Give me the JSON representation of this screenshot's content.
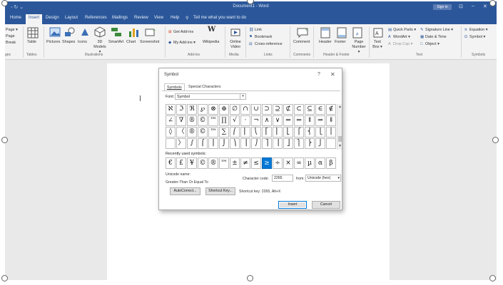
{
  "titlebar": {
    "qat": "◦ ↻ ⌄",
    "doc_title": "Document1 - Word",
    "sign_in": "Sign in",
    "share": "⊡",
    "minimize": "–",
    "restore": "❐",
    "close": "✕"
  },
  "tabs": [
    "Home",
    "Insert",
    "Design",
    "Layout",
    "References",
    "Mailings",
    "Review",
    "View",
    "Help",
    "Tell me what you want to do"
  ],
  "ribbon": {
    "pages": [
      "Page ▾",
      "Page",
      "Break"
    ],
    "pages_label": "ges",
    "table": "Table",
    "tables_label": "Tables",
    "illustrations": [
      "Pictures",
      "Shapes",
      "Icons",
      "3D Models ▾",
      "SmartArt",
      "Chart",
      "Screenshot"
    ],
    "illustrations_label": "Illustrations",
    "addins": [
      "Get Add-ins",
      "My Add-ins ▾",
      "Wikipedia"
    ],
    "addins_label": "Add-ins",
    "media": [
      "Online Video"
    ],
    "media_label": "Media",
    "links": [
      "Link",
      "Bookmark",
      "Cross-reference"
    ],
    "links_label": "Links",
    "comment": "Comment",
    "comments_label": "Comments",
    "header_footer": [
      "Header",
      "Footer",
      "Page Number ▾"
    ],
    "header_footer_label": "Header & Footer",
    "text_items": [
      "Text Box ▾",
      "Quick Parts ▾",
      "WordArt ▾",
      "Drop Cap ▾",
      "Signature Line ▾",
      "Date & Time",
      "Object ▾"
    ],
    "text_label": "Text",
    "symbols": [
      "Equation ▾",
      "Symbol ▾"
    ],
    "symbols_label": "Symbols"
  },
  "dialog": {
    "title": "Symbol",
    "help": "?",
    "close": "✕",
    "tabs": [
      "Symbols",
      "Special Characters"
    ],
    "font_label": "Font:",
    "font_value": "Symbol",
    "symbols": [
      [
        "ℵ",
        "ℑ",
        "ℜ",
        "℘",
        "⊗",
        "⊕",
        "∅",
        "∩",
        "∪",
        "⊃",
        "⊇",
        "⊄",
        "⊂",
        "⊆",
        "∈",
        "∉"
      ],
      [
        "∠",
        "∇",
        "®",
        "©",
        "™",
        "∏",
        "√",
        "⋅",
        "¬",
        "∧",
        "∨",
        "⇔",
        "⇐",
        "⇑",
        "⇒",
        "⇓"
      ],
      [
        "◊",
        "〈",
        "®",
        "©",
        "™",
        "∑",
        "⎛",
        "⎜",
        "⎝",
        "⎡",
        "⎢",
        "⎣",
        "⎧",
        "⎨",
        "⎩",
        "⎪"
      ],
      [
        "",
        "〉",
        "∫",
        "⌠",
        "⎮",
        "⌡",
        "⎞",
        "⎟",
        "⎠",
        "⎤",
        "⎥",
        "⎦",
        "⎫",
        "⎬",
        "⎭",
        ""
      ]
    ],
    "recent_label": "Recently used symbols:",
    "recent": [
      "€",
      "£",
      "¥",
      "©",
      "®",
      "™",
      "±",
      "≠",
      "≤",
      "≥",
      "÷",
      "×",
      "∞",
      "µ",
      "α",
      "β"
    ],
    "recent_selected": 9,
    "unicode_name_label": "Unicode name:",
    "unicode_name": "Greater-Than Or Equal To",
    "char_code_label": "Character code:",
    "char_code": "2265",
    "from_label": "from:",
    "from_value": "Unicode (hex)",
    "autocorrect": "AutoCorrect...",
    "shortcut_key": "Shortcut Key...",
    "shortcut_text": "Shortcut key: 2265, Alt+X",
    "insert": "Insert",
    "cancel": "Cancel"
  }
}
